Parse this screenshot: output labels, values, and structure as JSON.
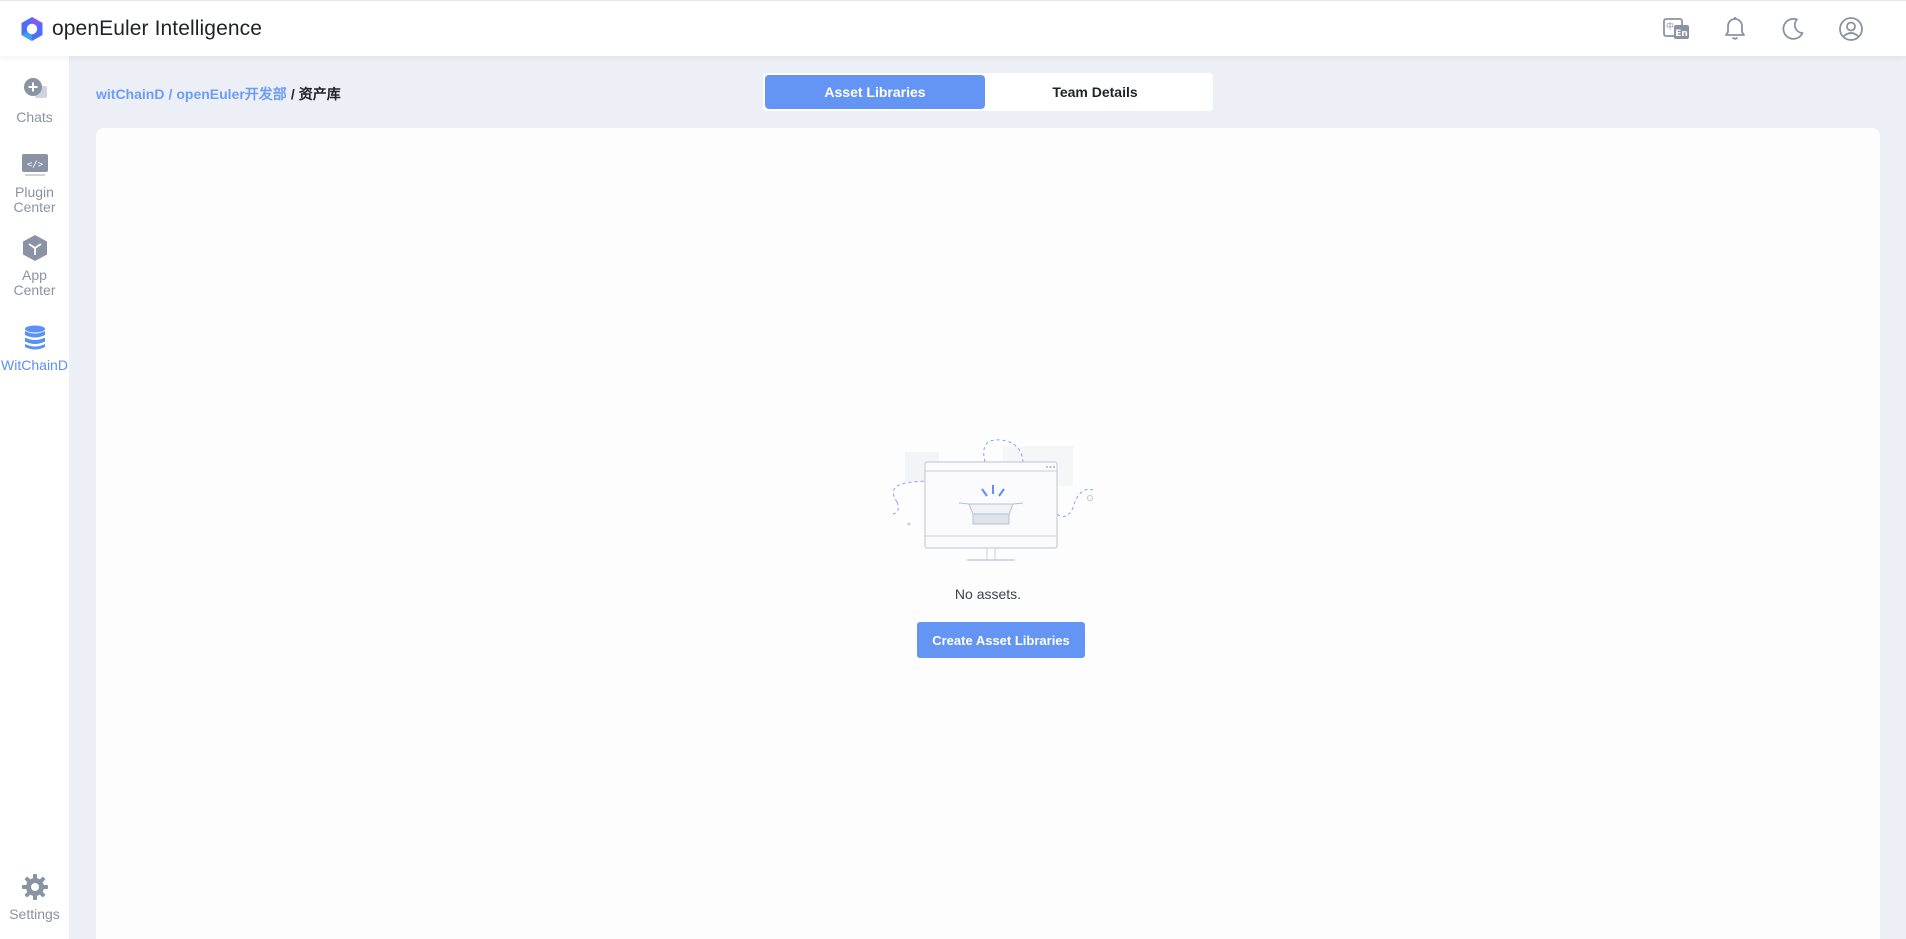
{
  "app": {
    "title": "openEuler Intelligence"
  },
  "topbar": {
    "icons": [
      "language-switch-icon",
      "bell-icon",
      "moon-icon",
      "user-icon"
    ]
  },
  "sidebar": {
    "items": [
      {
        "label": "Chats",
        "icon": "chat-icon",
        "active": false
      },
      {
        "label": "Plugin Center",
        "icon": "plugin-icon",
        "active": false
      },
      {
        "label": "App Center",
        "icon": "cube-icon",
        "active": false
      },
      {
        "label": "WitChainD",
        "icon": "database-icon",
        "active": true
      }
    ],
    "settings": {
      "label": "Settings",
      "icon": "gear-icon"
    }
  },
  "breadcrumb": {
    "items": [
      "witChainD",
      "openEuler开发部",
      "资产库"
    ],
    "separator": "/"
  },
  "tabs": [
    {
      "label": "Asset Libraries",
      "active": true
    },
    {
      "label": "Team Details",
      "active": false
    }
  ],
  "empty_state": {
    "message": "No assets.",
    "button_label": "Create Asset Libraries"
  },
  "colors": {
    "accent": "#6495f5",
    "link": "#6d9cf8",
    "background": "#eceff5",
    "sidebar_label": "#8a93a3"
  }
}
